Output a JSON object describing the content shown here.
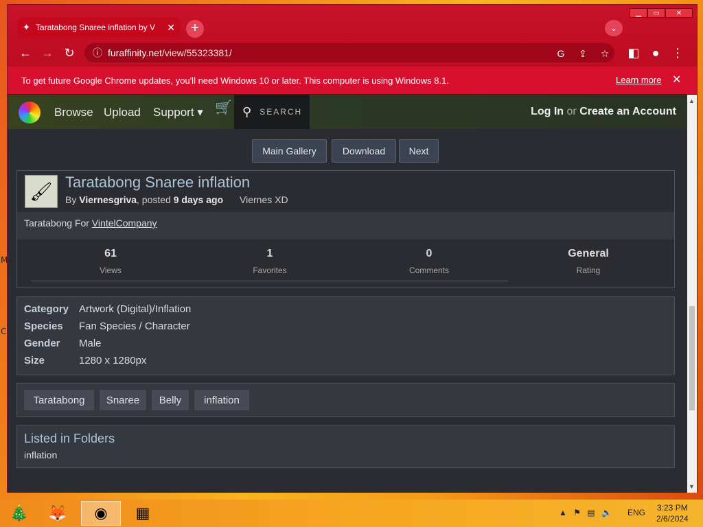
{
  "browser": {
    "tab_title": "Taratabong Snaree inflation by V",
    "url_host": "furaffinity.net",
    "url_path": "/view/55323381/",
    "infobar_message": "To get future Google Chrome updates, you'll need Windows 10 or later. This computer is using Windows 8.1.",
    "infobar_link": "Learn more"
  },
  "site_nav": {
    "browse": "Browse",
    "upload": "Upload",
    "support": "Support ▾",
    "search_placeholder": "SEARCH",
    "login": "Log In",
    "or": "or",
    "create_account": "Create an Account"
  },
  "gallery_buttons": [
    "Main Gallery",
    "Download",
    "Next"
  ],
  "submission": {
    "title": "Taratabong Snaree inflation",
    "by_prefix": "By",
    "author": "Viernesgriva",
    "posted_prefix": ", posted",
    "posted_when": "9 days ago",
    "display_name": "Viernes XD",
    "description_prefix": "Taratabong For",
    "description_link": "VintelCompany"
  },
  "stats": [
    {
      "value": "61",
      "label": "Views"
    },
    {
      "value": "1",
      "label": "Favorites"
    },
    {
      "value": "0",
      "label": "Comments"
    },
    {
      "value": "General",
      "label": "Rating"
    }
  ],
  "info": [
    {
      "key": "Category",
      "value": "Artwork (Digital)/Inflation"
    },
    {
      "key": "Species",
      "value": "Fan Species / Character"
    },
    {
      "key": "Gender",
      "value": "Male"
    },
    {
      "key": "Size",
      "value": "1280 x 1280px"
    }
  ],
  "tags": [
    "Taratabong",
    "Snaree",
    "Belly",
    "inflation"
  ],
  "folders": {
    "title": "Listed in Folders",
    "item": "inflation"
  },
  "taskbar": {
    "language": "ENG",
    "time": "3:23 PM",
    "date": "2/6/2024"
  },
  "colors": {
    "chrome_red": "#c8122a",
    "page_bg": "#2a2c31",
    "title_blue": "#aec6da"
  }
}
